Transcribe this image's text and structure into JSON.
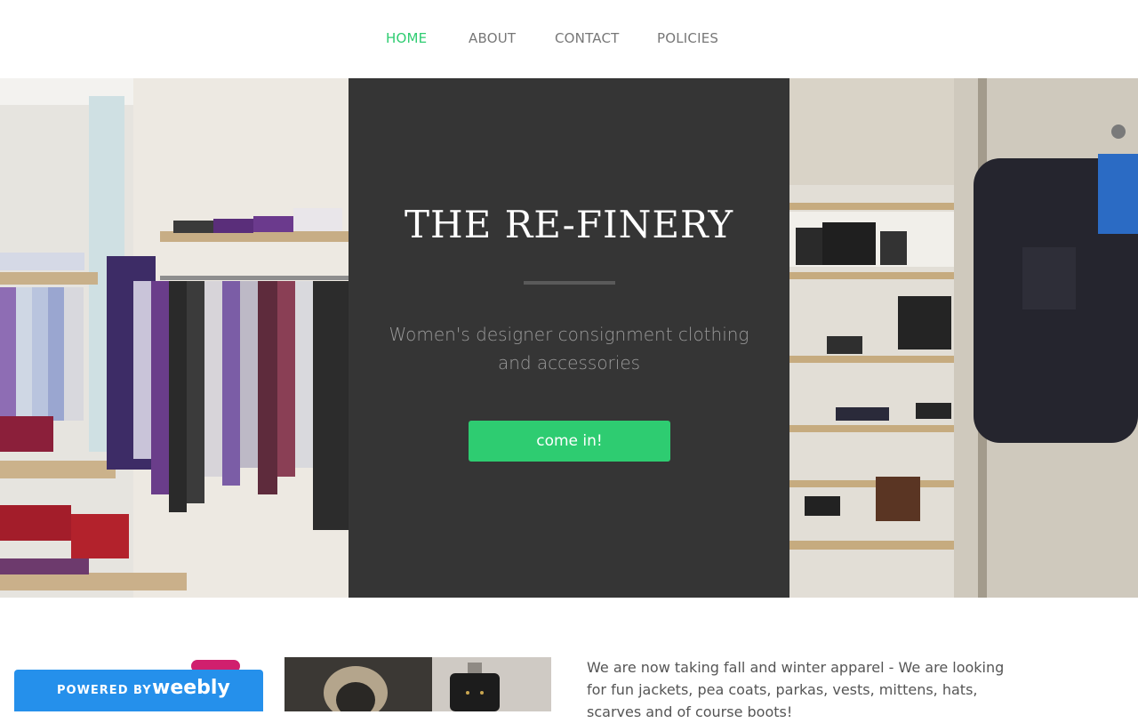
{
  "nav": {
    "items": [
      {
        "label": "HOME",
        "active": true
      },
      {
        "label": "ABOUT",
        "active": false
      },
      {
        "label": "CONTACT",
        "active": false
      },
      {
        "label": "POLICIES",
        "active": false
      }
    ]
  },
  "hero": {
    "title": "THE RE-FINERY",
    "subtitle": "Women's designer consignment clothing and accessories",
    "button_label": "come in!"
  },
  "content": {
    "paragraph": "We are now taking fall and winter apparel - We are looking for fun jackets, pea coats, parkas, vests, mittens, hats, scarves and of course boots!"
  },
  "badge": {
    "powered_label": "POWERED BY",
    "brand": "weebly"
  },
  "colors": {
    "accent": "#2ecc71",
    "panel": "#353535",
    "badge": "#2590eb"
  }
}
